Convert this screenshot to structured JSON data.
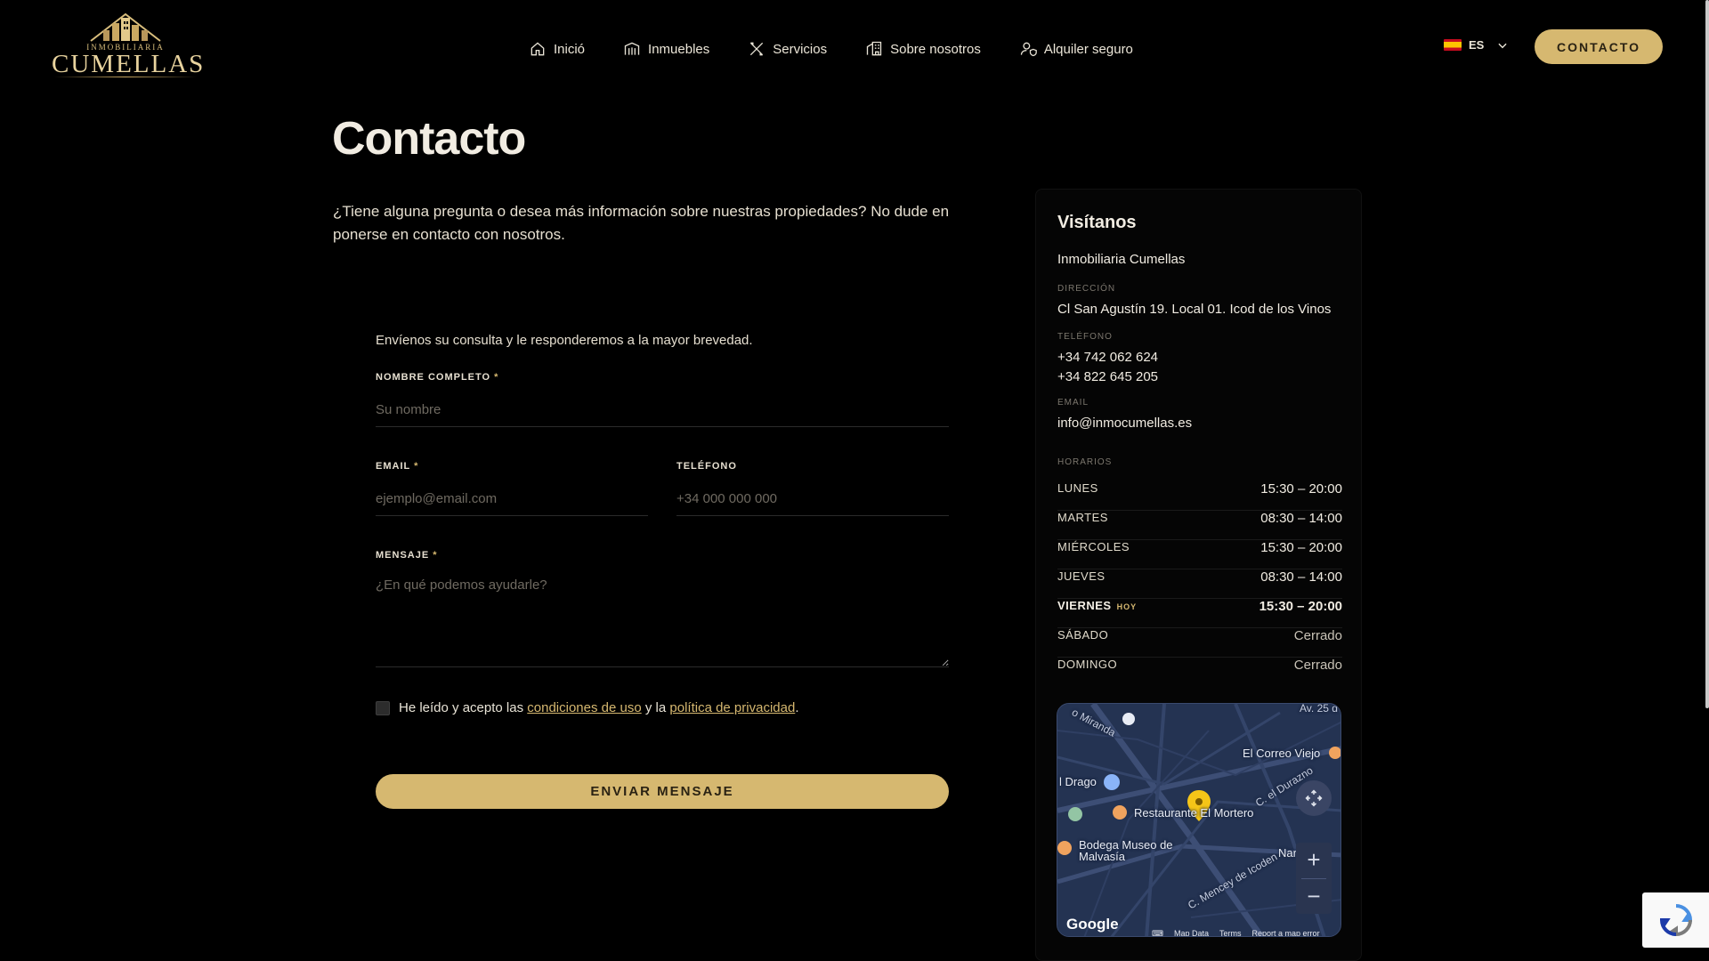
{
  "logo": {
    "top_text": "INMOBILIARIA",
    "name": "CUMELLAS"
  },
  "nav": {
    "items": [
      {
        "label": "Inició",
        "icon": "home-icon"
      },
      {
        "label": "Inmuebles",
        "icon": "building-icon"
      },
      {
        "label": "Servicios",
        "icon": "tools-icon"
      },
      {
        "label": "Sobre nosotros",
        "icon": "office-icon"
      },
      {
        "label": "Alquiler seguro",
        "icon": "user-shield-icon"
      }
    ]
  },
  "language": {
    "code": "ES",
    "flag": "spain-flag-icon"
  },
  "header": {
    "contact_label": "CONTACTO"
  },
  "page": {
    "title": "Contacto",
    "intro": "¿Tiene alguna pregunta o desea más información sobre nuestras propiedades? No dude en ponerse en contacto con nosotros."
  },
  "form": {
    "lead": "Envíenos su consulta y le responderemos a la mayor brevedad.",
    "name_label": "NOMBRE COMPLETO",
    "name_placeholder": "Su nombre",
    "email_label": "EMAIL",
    "email_placeholder": "ejemplo@email.com",
    "phone_label": "TELÉFONO",
    "phone_placeholder": "+34 000 000 000",
    "message_label": "MENSAJE",
    "message_placeholder": "¿En qué podemos ayudarle?",
    "required_mark": "*",
    "consent_prefix": "He leído y acepto las",
    "consent_terms": "condiciones de uso",
    "consent_mid": "y la",
    "consent_privacy": "política de privacidad",
    "consent_suffix": ".",
    "submit_label": "ENVIAR MENSAJE"
  },
  "info": {
    "title": "Visítanos",
    "company": "Inmobiliaria Cumellas",
    "address_label": "DIRECCIÓN",
    "address": "Cl San Agustín 19. Local 01. Icod de los Vinos",
    "phone_label": "TELÉFONO",
    "phones": [
      "+34 742 062 624",
      "+34 822 645 205"
    ],
    "email_label": "EMAIL",
    "email": "info@inmocumellas.es",
    "hours_label": "HORARIOS",
    "today_badge": "HOY",
    "hours": [
      {
        "day": "LUNES",
        "time": "15:30 – 20:00"
      },
      {
        "day": "MARTES",
        "time": "08:30 – 14:00"
      },
      {
        "day": "MIÉRCOLES",
        "time": "15:30 – 20:00"
      },
      {
        "day": "JUEVES",
        "time": "08:30 – 14:00"
      },
      {
        "day": "VIERNES",
        "time": "15:30 – 20:00"
      },
      {
        "day": "SÁBADO",
        "time": "Cerrado"
      },
      {
        "day": "DOMINGO",
        "time": "Cerrado"
      }
    ]
  },
  "map": {
    "labels": {
      "miranda": "o Miranda",
      "av": "Av. 25 d",
      "correo": "El Correo Viejo",
      "drago": "l Drago",
      "durazno": "C. el Durazno",
      "restaurant": "Restaurante El Mortero",
      "bodega": "Bodega Museo de Malvasía",
      "mencey": "C. Mencey de Icoden",
      "nar": "Nar",
      "logo": "Google"
    },
    "footer": {
      "data": "Map Data",
      "terms": "Terms",
      "report": "Report a map error"
    }
  },
  "colors": {
    "accent": "#d6b870",
    "background": "#000000",
    "map_bg": "#243352"
  }
}
